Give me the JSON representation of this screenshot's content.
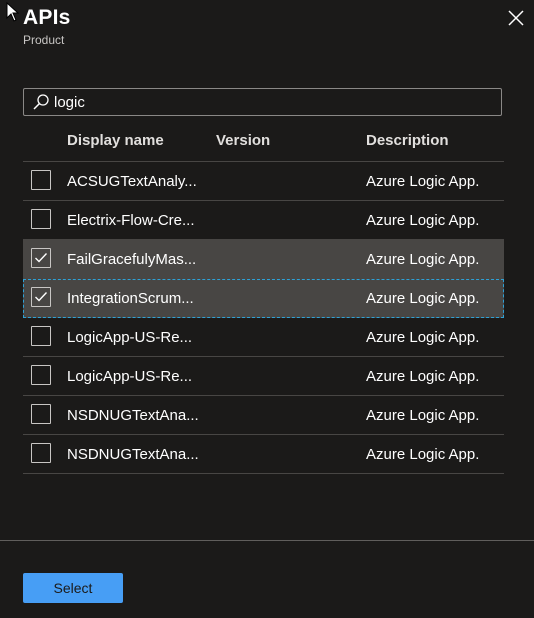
{
  "panel": {
    "title": "APIs",
    "subtitle": "Product"
  },
  "search": {
    "value": "logic"
  },
  "table": {
    "columns": [
      "Display name",
      "Version",
      "Description"
    ],
    "rows": [
      {
        "name": "ACSUGTextAnaly...",
        "version": "",
        "description": "Azure Logic App.",
        "checked": false
      },
      {
        "name": "Electrix-Flow-Cre...",
        "version": "",
        "description": "Azure Logic App.",
        "checked": false
      },
      {
        "name": "FailGracefulyMas...",
        "version": "",
        "description": "Azure Logic App.",
        "checked": true
      },
      {
        "name": "IntegrationScrum...",
        "version": "",
        "description": "Azure Logic App.",
        "checked": true
      },
      {
        "name": "LogicApp-US-Re...",
        "version": "",
        "description": "Azure Logic App.",
        "checked": false
      },
      {
        "name": "LogicApp-US-Re...",
        "version": "",
        "description": "Azure Logic App.",
        "checked": false
      },
      {
        "name": "NSDNUGTextAna...",
        "version": "",
        "description": "Azure Logic App.",
        "checked": false
      },
      {
        "name": "NSDNUGTextAna...",
        "version": "",
        "description": "Azure Logic App.",
        "checked": false
      }
    ]
  },
  "footer": {
    "select_label": "Select"
  },
  "icons": {
    "cursor": "mouse-pointer-icon",
    "close": "close-icon",
    "search": "search-icon",
    "check": "checkmark-icon"
  },
  "colors": {
    "background": "#1b1a19",
    "selected_row": "#484644",
    "focus_outline": "#2ea1d6",
    "primary_button": "#479ef5"
  }
}
